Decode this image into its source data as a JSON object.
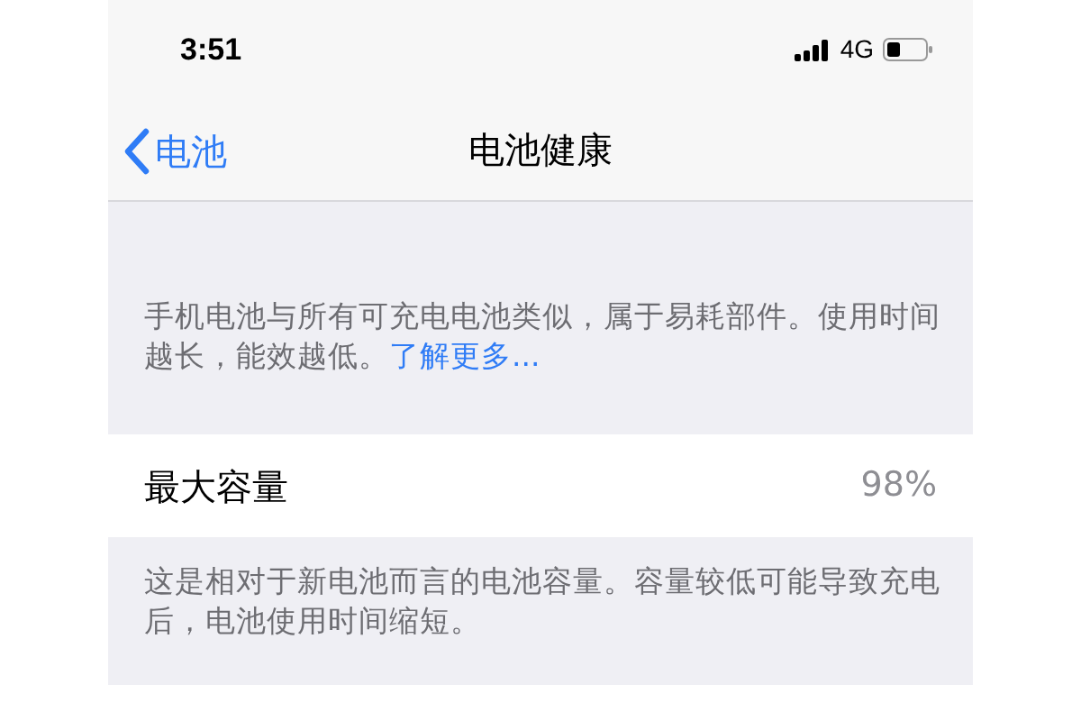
{
  "status_bar": {
    "time": "3:51",
    "network": "4G"
  },
  "nav": {
    "back": "电池",
    "title": "电池健康"
  },
  "intro": {
    "text": "手机电池与所有可充电电池类似，属于易耗部件。使用时间越长，能效越低。",
    "link": "了解更多..."
  },
  "rows": [
    {
      "label": "最大容量",
      "value": "98%",
      "footer": "这是相对于新电池而言的电池容量。容量较低可能导致充电后，电池使用时间缩短。"
    }
  ]
}
